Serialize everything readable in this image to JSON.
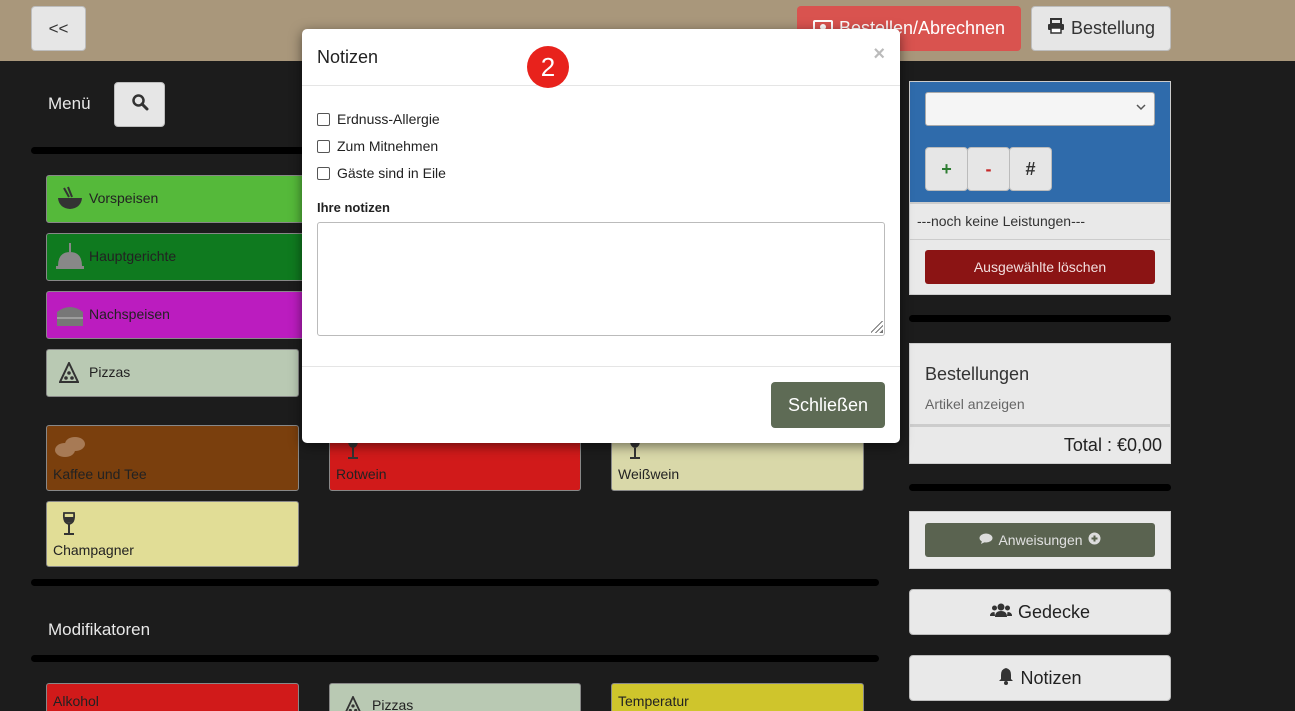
{
  "topbar": {
    "back_label": "<<",
    "checkout_label": "Bestellen/Abrechnen",
    "order_label": "Bestellung"
  },
  "menu": {
    "title": "Menü",
    "categories": [
      {
        "label": "Vorspeisen",
        "color": "#55b93a",
        "icon": "bowl-icon"
      },
      {
        "label": "Hauptgerichte",
        "color": "#0f7a1f",
        "icon": "cloche-icon"
      },
      {
        "label": "Nachspeisen",
        "color": "#bb1cbf",
        "icon": "cake-icon"
      },
      {
        "label": "Pizzas",
        "color": "#b9c9b3",
        "icon": "pizza-icon"
      },
      {
        "label": "Kaffee und Tee",
        "color": "#7a3f0d",
        "icon": "coffee-beans-icon"
      },
      {
        "label": "Rotwein",
        "color": "#d11a1a",
        "icon": "wine-glass-icon"
      },
      {
        "label": "Weißwein",
        "color": "#d9d8a9",
        "icon": "wine-glass-icon"
      },
      {
        "label": "Champagner",
        "color": "#e1dd96",
        "icon": "wine-glass-icon"
      }
    ]
  },
  "modifiers": {
    "title": "Modifikatoren",
    "items": [
      {
        "label": "Alkohol",
        "color": "#d11a1a"
      },
      {
        "label": "Pizzas",
        "color": "#b9c9b3",
        "icon": "pizza-icon"
      },
      {
        "label": "Temperatur",
        "color": "#cfc52c"
      }
    ]
  },
  "right_panel": {
    "qty_buttons": [
      "+",
      "-",
      "#"
    ],
    "no_items": "---noch keine Leistungen---",
    "delete_label": "Ausgewählte löschen",
    "orders_title": "Bestellungen",
    "orders_sub": "Artikel anzeigen",
    "total": "Total : €0,00",
    "instructions_label": "Anweisungen",
    "covers_label": "Gedecke",
    "notes_label": "Notizen"
  },
  "modal": {
    "title": "Notizen",
    "close_x": "×",
    "badge": "2",
    "options": [
      "Erdnuss-Allergie",
      "Zum Mitnehmen",
      "Gäste sind in Eile"
    ],
    "notes_label": "Ihre notizen",
    "notes_value": "",
    "close_label": "Schließen"
  }
}
